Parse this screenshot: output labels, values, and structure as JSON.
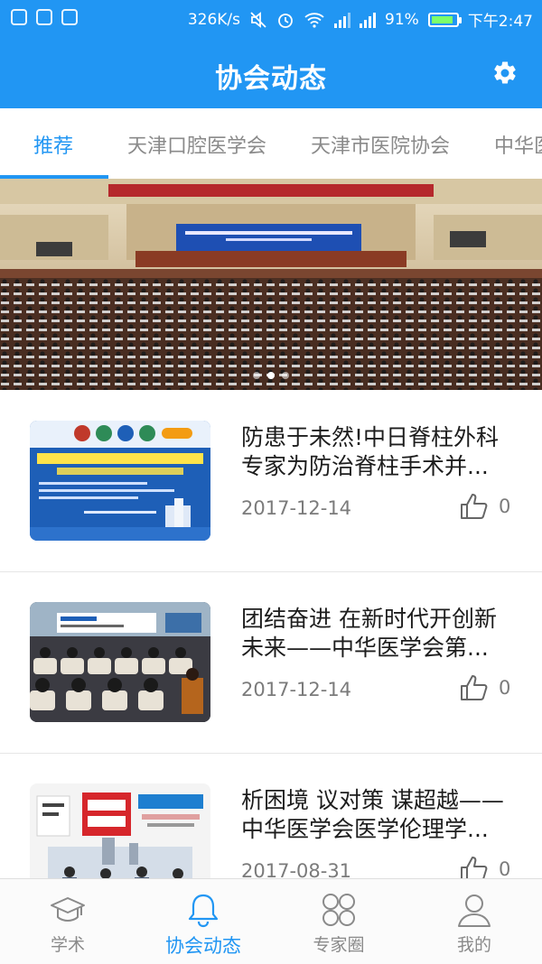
{
  "status_bar": {
    "net_speed": "326K/s",
    "battery": "91%",
    "battery_level": 0.91,
    "time": "下午2:47"
  },
  "header": {
    "title": "协会动态",
    "settings_icon": "gear-icon"
  },
  "tabs": [
    {
      "label": "推荐",
      "active": true
    },
    {
      "label": "天津口腔医学会",
      "active": false
    },
    {
      "label": "天津市医院协会",
      "active": false
    },
    {
      "label": "中华医",
      "active": false
    }
  ],
  "banner": {
    "image": "conference-hall-photo",
    "slide_count": 3,
    "active_slide": 2
  },
  "articles": [
    {
      "title": "防患于未然!中日脊柱外科专家为防治脊柱手术并...",
      "date": "2017-12-14",
      "likes": "0",
      "thumbnail": "spine-surgery-conference-poster"
    },
    {
      "title": "团结奋进 在新时代开创新未来——中华医学会第...",
      "date": "2017-12-14",
      "likes": "0",
      "thumbnail": "conference-audience-photo"
    },
    {
      "title": "析困境 议对策 谋超越——中华医学会医学伦理学...",
      "date": "2017-08-31",
      "likes": "0",
      "thumbnail": "medical-ethics-forum-photo"
    }
  ],
  "bottom_nav": [
    {
      "label": "学术",
      "icon": "graduation-cap-icon",
      "active": false
    },
    {
      "label": "协会动态",
      "icon": "bell-icon",
      "active": true
    },
    {
      "label": "专家圈",
      "icon": "grid-circles-icon",
      "active": false
    },
    {
      "label": "我的",
      "icon": "user-icon",
      "active": false
    }
  ],
  "colors": {
    "primary": "#2196f3",
    "text_dark": "#1d1d1d",
    "text_gray": "#7b7b7b"
  }
}
